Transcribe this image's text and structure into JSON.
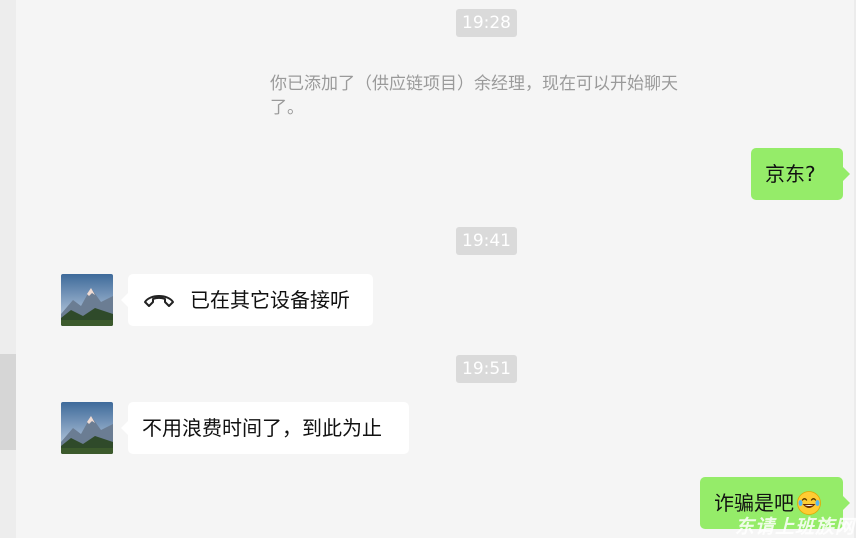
{
  "chat": {
    "times": [
      "19:28",
      "19:41",
      "19:51"
    ],
    "system_message": "你已添加了（供应链项目）余经理，现在可以开始聊天了。",
    "messages": [
      {
        "direction": "out",
        "text": "京东?"
      },
      {
        "direction": "in",
        "text": "已在其它设备接听",
        "icon": "phone-hangup-icon"
      },
      {
        "direction": "in",
        "text": "不用浪费时间了，到此为止"
      },
      {
        "direction": "out",
        "text": "诈骗是吧",
        "emoji": "laughing-tears-emoji-icon"
      }
    ]
  },
  "watermark": "东请上班族网",
  "colors": {
    "background": "#f5f5f5",
    "outgoing_bubble": "#95ec69",
    "incoming_bubble": "#ffffff",
    "time_badge": "#dadada",
    "system_text": "#9a9a9a"
  }
}
